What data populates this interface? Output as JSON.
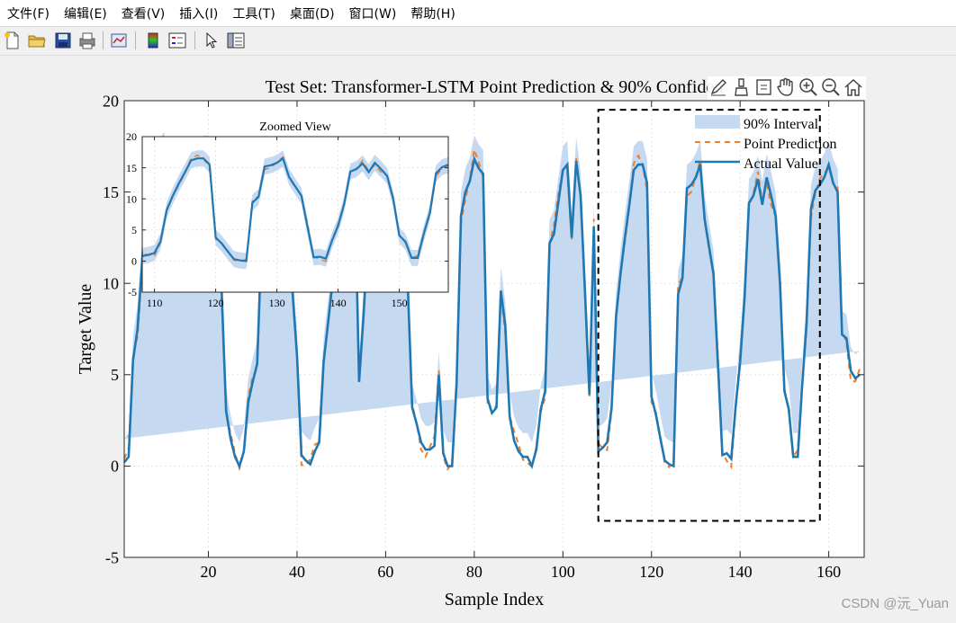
{
  "menu": [
    "文件(F)",
    "编辑(E)",
    "查看(V)",
    "插入(I)",
    "工具(T)",
    "桌面(D)",
    "窗口(W)",
    "帮助(H)"
  ],
  "toolbar_icons": [
    "new-file-icon",
    "open-folder-icon",
    "save-icon",
    "print-icon",
    "link-plot-icon",
    "colorbar-icon",
    "legend-icon",
    "pointer-icon",
    "property-inspector-icon"
  ],
  "axes_toolbar_icons": [
    "edit-plot-icon",
    "brush-icon",
    "data-tips-icon",
    "pan-hand-icon",
    "zoom-in-icon",
    "zoom-out-icon",
    "home-icon"
  ],
  "watermark": "CSDN @沅_Yuan",
  "chart_data": [
    {
      "type": "area",
      "title": "Test Set: Transformer-LSTM Point Prediction & 90% Confiden",
      "xlabel": "Sample Index",
      "ylabel": "Target Value",
      "xlim": [
        1,
        168
      ],
      "ylim": [
        -5,
        20
      ],
      "xticks": [
        20,
        40,
        60,
        80,
        100,
        120,
        140,
        160
      ],
      "yticks": [
        -5,
        0,
        5,
        10,
        15,
        20
      ],
      "grid": "on",
      "legend_position": "top-right",
      "interval_halfwidth": 1.3,
      "zoom_box": {
        "x": [
          108,
          158
        ],
        "y": [
          -3,
          19.5
        ]
      },
      "series": [
        {
          "name": "90% Interval",
          "color": "#c5d9f1"
        },
        {
          "name": "Point Prediction",
          "color": "#f07f2a"
        },
        {
          "name": "Actual Value",
          "color": "#1f77b4"
        }
      ],
      "x": [
        1,
        2,
        3,
        4,
        5,
        6,
        7,
        8,
        9,
        10,
        11,
        12,
        13,
        14,
        15,
        16,
        17,
        18,
        19,
        20,
        21,
        22,
        23,
        24,
        25,
        26,
        27,
        28,
        29,
        30,
        31,
        32,
        33,
        34,
        35,
        36,
        37,
        38,
        39,
        40,
        41,
        42,
        43,
        44,
        45,
        46,
        47,
        48,
        49,
        50,
        51,
        52,
        53,
        54,
        55,
        56,
        57,
        58,
        59,
        60,
        61,
        62,
        63,
        64,
        65,
        66,
        67,
        68,
        69,
        70,
        71,
        72,
        73,
        74,
        75,
        76,
        77,
        78,
        79,
        80,
        81,
        82,
        83,
        84,
        85,
        86,
        87,
        88,
        89,
        90,
        91,
        92,
        93,
        94,
        95,
        96,
        97,
        98,
        99,
        100,
        101,
        102,
        103,
        104,
        105,
        106,
        107,
        108,
        109,
        110,
        111,
        112,
        113,
        114,
        115,
        116,
        117,
        118,
        119,
        120,
        121,
        122,
        123,
        124,
        125,
        126,
        127,
        128,
        129,
        130,
        131,
        132,
        133,
        134,
        135,
        136,
        137,
        138,
        139,
        140,
        141,
        142,
        143,
        144,
        145,
        146,
        147,
        148,
        149,
        150,
        151,
        152,
        153,
        154,
        155,
        156,
        157,
        158,
        159,
        160,
        161,
        162,
        163,
        164,
        165,
        166,
        167,
        168
      ],
      "actual": [
        0.2,
        0.5,
        5.8,
        7.5,
        11,
        14.5,
        15.8,
        16.3,
        16.6,
        17,
        15.5,
        14.2,
        9.8,
        12.5,
        14,
        15.5,
        16.2,
        16.5,
        16.8,
        16.8,
        16.5,
        15.5,
        9.5,
        3,
        1.5,
        0.5,
        0.0,
        0.8,
        3.5,
        4.6,
        5.6,
        12.5,
        15,
        16,
        16.5,
        16.5,
        15.5,
        15,
        9.5,
        6,
        0.6,
        0.3,
        0.1,
        0.8,
        1.3,
        5.7,
        7.8,
        10,
        15.2,
        15.8,
        16.5,
        16.3,
        15.8,
        4.6,
        8.2,
        12.5,
        16.5,
        16.5,
        15.8,
        16.2,
        16.3,
        16.3,
        15.8,
        15.4,
        9.9,
        3.2,
        2.3,
        1.3,
        0.9,
        0.9,
        1.1,
        5,
        0.7,
        0.0,
        0.0,
        4.5,
        13.7,
        15,
        15.6,
        16.8,
        16.3,
        16.0,
        3.7,
        2.9,
        3.2,
        9.6,
        7.7,
        2.7,
        1.4,
        0.8,
        0.5,
        0.5,
        0.0,
        0.9,
        3.1,
        4.1,
        12.2,
        12.7,
        14.5,
        16.2,
        16.5,
        12.5,
        16.7,
        14.8,
        9.5,
        3.9,
        13.1,
        0.8,
        1.0,
        1.3,
        3.2,
        8.2,
        10.5,
        12.5,
        14.3,
        16.2,
        16.5,
        16.5,
        15.5,
        3.8,
        2.8,
        1.5,
        0.3,
        0.1,
        0.0,
        9.4,
        10.3,
        15.2,
        15.4,
        15.8,
        16.5,
        13.5,
        12,
        10.5,
        5.5,
        0.6,
        0.7,
        0.4,
        3.3,
        5.7,
        9.2,
        14.4,
        14.8,
        15.7,
        14.3,
        15.8,
        14.8,
        13.7,
        10,
        4.1,
        3.1,
        0.5,
        0.5,
        4.4,
        7.8,
        14.1,
        15.1,
        15.4,
        15.8,
        16.5,
        15.5,
        15.0,
        7.2,
        7.0,
        5.2,
        4.8,
        5.0
      ]
    },
    {
      "type": "line",
      "title": "Zoomed View",
      "xlim": [
        108,
        158
      ],
      "ylim": [
        -5,
        20
      ],
      "xticks": [
        110,
        120,
        130,
        140,
        150
      ],
      "yticks": [
        -5,
        0,
        5,
        10,
        15,
        20
      ],
      "grid": "on"
    }
  ]
}
